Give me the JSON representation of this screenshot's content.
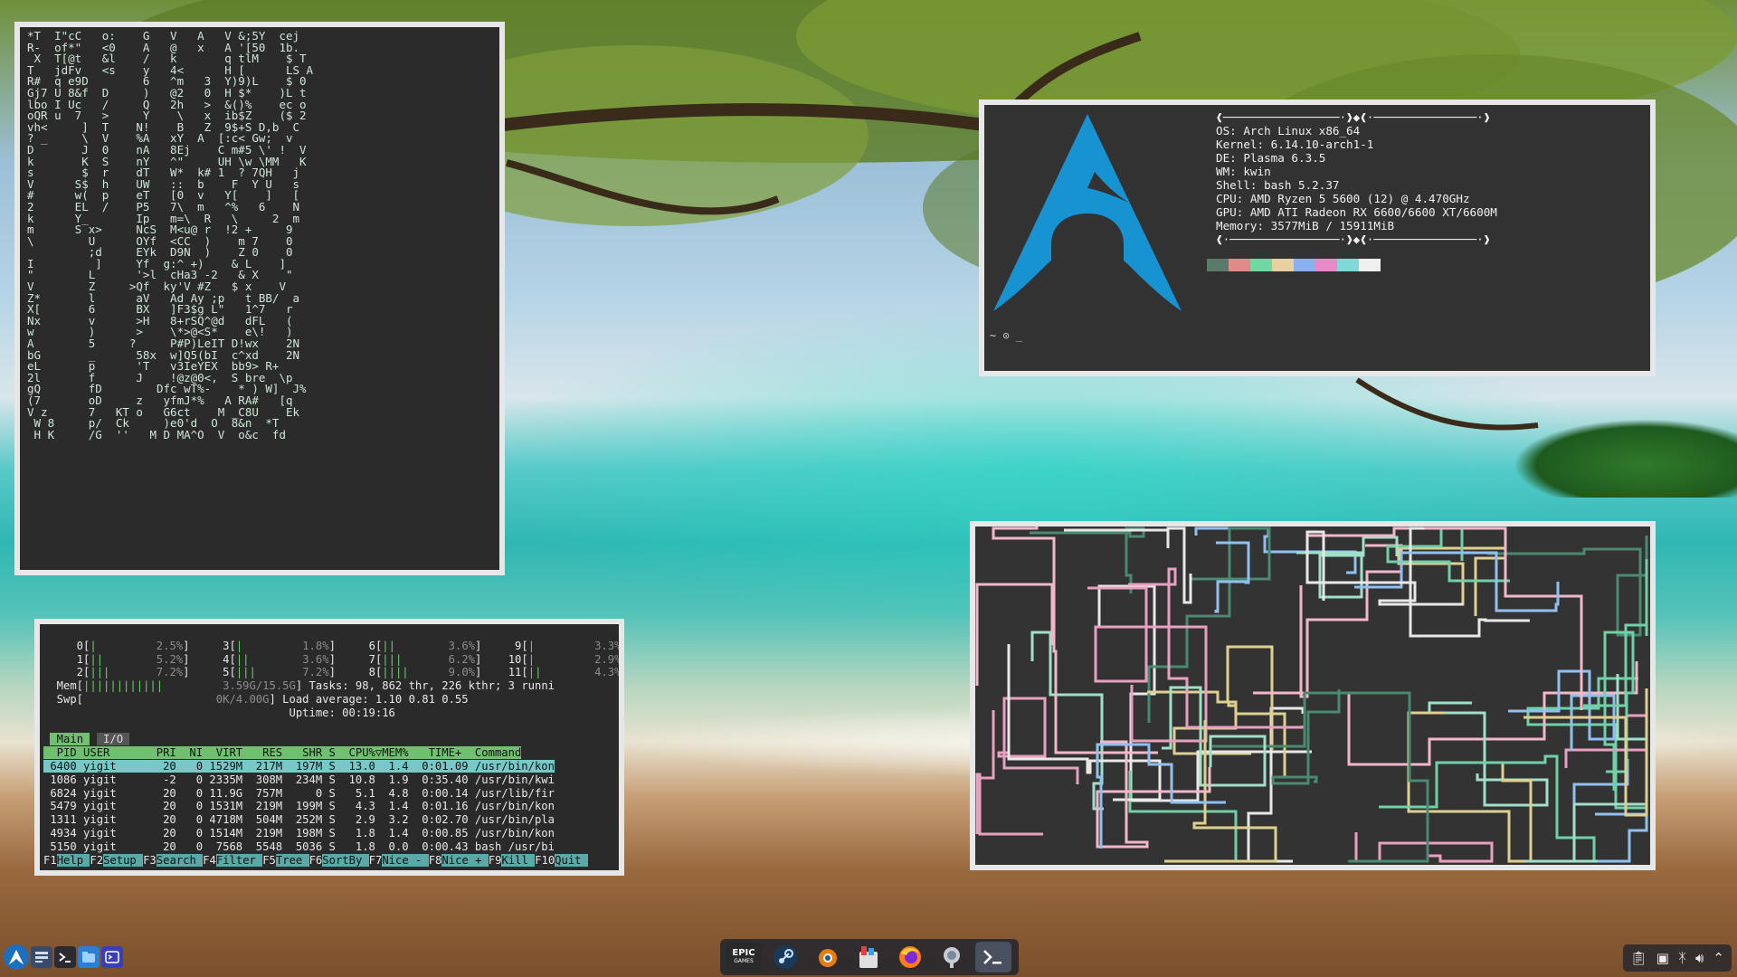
{
  "matrix": {
    "lines": [
      "*T  I\"cC   o:    G   V   A   V &;5Y  cej",
      "R-  of*\"   <0    A   @   x   A '[50  1b.",
      " X  T[@t   &l    /   k       q tlM    $ T",
      "T   jdFv   <s    y   4<      H [      LS A",
      "R#  q e9D        6   ^m   3  Y)9)L    $ 0",
      "Gj7 U 8&f  D     )   @2   0  H $*    )L t",
      "lbo I Uc   /     Q   2h   >  &()%    ec o",
      "oQR u  7   >     Y    \\   x  ib$Z    ($ 2",
      "vh<     ]  T    N!    B   Z  9$+S D,b  C",
      "? _     \\  V    %A   xY  A  [:c< Gw;  v",
      "D       J  0    nA   8Ej    C m#5 \\' !  V",
      "k       K  S    nY   ^\"     UH \\w \\MM   K",
      "s       $  r    dT   W*  k# 1  ? 7QH   j",
      "V      S$  h    UW   ::  b    F  Y U   s",
      "#      w(  p    eT   [0  v   Y[    ]   [",
      "2      EL  /    P5   7\\  m   ^%   6    N",
      "k      Y_       Ip   m=\\  R   \\     2  m",
      "m      S x>     NcS  M<u@ r  !2 +     9",
      "\\        U      OYf  <CC  )    m 7    0",
      "         ;d     EYk  D9N  )    Z 0    0",
      "I         ]     Yf  g:^ +)    & L    ]",
      "\"        L      '>l  cHa3 -2   & X    \"",
      "V        Z     >Qf  ky'V #Z   $ x    V",
      "Z*       l      aV   Ad Ay ;p   t BB/  a",
      "X[       6      BX   ]F3$g L\"   1^7   r",
      "Nx       v      >H   8+rSQ^@d   dFL   (",
      "w        )      >    \\*>@<S*    e\\!   )",
      "A        5     ?     P#P)LeIT D!wx    2N",
      "bG       _      58x  w]Q5(bI  c^xd    2N",
      "eL       p      'T   v3IeYEX  bb9> R+",
      "2l       f      J    !@z@0<,  S bre  \\p",
      "gQ       fD        Dfc wT%-    * ) W]  J%",
      "(7       oD     z   yfmJ*%   A RA#   [q",
      "V z      7   KT o   G6ct    M _C8U    Ek",
      " W 8     p/  Ck     )e0'd  O  8&n  *T",
      " H K     /G  ''   M D MA^O  V  o&c  fd"
    ]
  },
  "fetch": {
    "header_top": "❰─────────────────·❱◆❰·───────────────·❱",
    "os": "OS: Arch Linux x86_64",
    "kernel": "Kernel: 6.14.10-arch1-1",
    "de": "DE: Plasma 6.3.5",
    "wm": "WM: kwin",
    "shell": "Shell: bash 5.2.37",
    "cpu": "CPU: AMD Ryzen 5 5600 (12) @ 4.470GHz",
    "gpu": "GPU: AMD ATI Radeon RX 6600/6600 XT/6600M",
    "memory": "Memory: 3577MiB / 15911MiB",
    "header_bottom": "❰·────────────────·❱◆❰·───────────────·❱",
    "prompt": "~ ⊙ _",
    "logo_color": "#1793d1",
    "palette": [
      "#5a7a6a",
      "#e08a8a",
      "#70d8a0",
      "#e8d0a0",
      "#8ab0f0",
      "#e88ac8",
      "#80d8d8",
      "#f0f0f0"
    ]
  },
  "htop": {
    "cpu_rows": [
      [
        "0",
        "2.5%",
        "3",
        "1.8%",
        "6",
        "3.6%",
        "9",
        "3.3%"
      ],
      [
        "1",
        "5.2%",
        "4",
        "3.6%",
        "7",
        "6.2%",
        "10",
        "2.9%"
      ],
      [
        "2",
        "7.2%",
        "5",
        "7.2%",
        "8",
        "9.0%",
        "11",
        "4.3%"
      ]
    ],
    "mem_label": "Mem",
    "mem_value": "3.59G/15.5G",
    "swp_label": "Swp",
    "swp_value": "0K/4.00G",
    "tasks": "Tasks: 98, 862 thr, 226 kthr; 3 runni",
    "load": "Load average: 1.10 0.81 0.55",
    "uptime": "Uptime: 00:19:16",
    "tab_main": "Main",
    "tab_io": "I/O",
    "columns": "  PID USER       PRI  NI  VIRT   RES   SHR S  CPU%▽MEM%   TIME+  Command",
    "processes": [
      {
        "pid": "6400",
        "user": "yigit",
        "pri": "20",
        "ni": "0",
        "virt": "1529M",
        "res": "217M",
        "shr": "197M",
        "s": "S",
        "cpu": "13.0",
        "mem": "1.4",
        "time": "0:01.09",
        "cmd": "/usr/bin/kon"
      },
      {
        "pid": "1086",
        "user": "yigit",
        "pri": "-2",
        "ni": "0",
        "virt": "2335M",
        "res": "308M",
        "shr": "234M",
        "s": "S",
        "cpu": "10.8",
        "mem": "1.9",
        "time": "0:35.40",
        "cmd": "/usr/bin/kwi"
      },
      {
        "pid": "6824",
        "user": "yigit",
        "pri": "20",
        "ni": "0",
        "virt": "11.9G",
        "res": "757M",
        "shr": "0",
        "s": "S",
        "cpu": "5.1",
        "mem": "4.8",
        "time": "0:00.14",
        "cmd": "/usr/lib/fir"
      },
      {
        "pid": "5479",
        "user": "yigit",
        "pri": "20",
        "ni": "0",
        "virt": "1531M",
        "res": "219M",
        "shr": "199M",
        "s": "S",
        "cpu": "4.3",
        "mem": "1.4",
        "time": "0:01.16",
        "cmd": "/usr/bin/kon"
      },
      {
        "pid": "1311",
        "user": "yigit",
        "pri": "20",
        "ni": "0",
        "virt": "4718M",
        "res": "504M",
        "shr": "252M",
        "s": "S",
        "cpu": "2.9",
        "mem": "3.2",
        "time": "0:02.70",
        "cmd": "/usr/bin/pla"
      },
      {
        "pid": "4934",
        "user": "yigit",
        "pri": "20",
        "ni": "0",
        "virt": "1514M",
        "res": "219M",
        "shr": "198M",
        "s": "S",
        "cpu": "1.8",
        "mem": "1.4",
        "time": "0:00.85",
        "cmd": "/usr/bin/kon"
      },
      {
        "pid": "5150",
        "user": "yigit",
        "pri": "20",
        "ni": "0",
        "virt": "7568",
        "res": "5548",
        "shr": "5036",
        "s": "S",
        "cpu": "1.8",
        "mem": "0.0",
        "time": "0:00.43",
        "cmd": "bash /usr/bi"
      }
    ],
    "fkeys": [
      [
        "F1",
        "Help"
      ],
      [
        "F2",
        "Setup"
      ],
      [
        "F3",
        "Search"
      ],
      [
        "F4",
        "Filter"
      ],
      [
        "F5",
        "Tree"
      ],
      [
        "F6",
        "SortBy"
      ],
      [
        "F7",
        "Nice -"
      ],
      [
        "F8",
        "Nice +"
      ],
      [
        "F9",
        "Kill"
      ],
      [
        "F10",
        "Quit"
      ]
    ]
  },
  "pipes": {
    "colors": [
      "#e8e8e8",
      "#f0b8c8",
      "#e8a0c0",
      "#e0d090",
      "#90c0f0",
      "#70d0a8",
      "#4a8a70",
      "#a0e0c8"
    ]
  },
  "taskbar": {
    "left_icons": [
      "arch-launcher-icon",
      "task-manager-icon",
      "terminal-icon",
      "dolphin-icon",
      "konsole-icon"
    ],
    "dock_epic_label": "EPIC",
    "dock_epic_sub": "GAMES",
    "dock_icons": [
      "epic-games-icon",
      "steam-icon",
      "blender-icon",
      "store-icon",
      "firefox-icon",
      "ghost-icon",
      "terminal-icon"
    ],
    "tray_icons": [
      "clipboard-icon",
      "network-icon",
      "bluetooth-icon",
      "volume-icon",
      "expand-icon"
    ]
  }
}
